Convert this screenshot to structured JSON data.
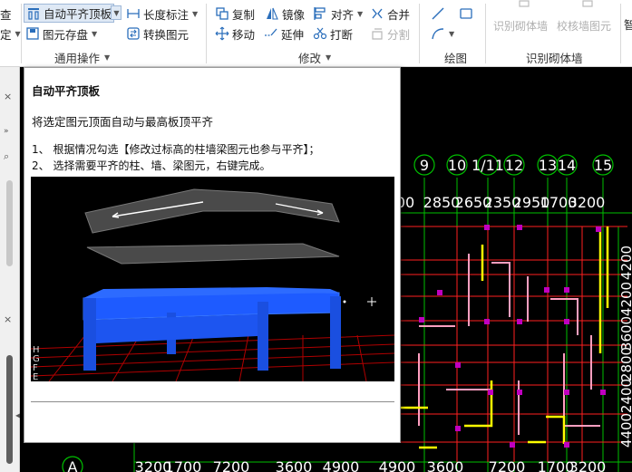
{
  "ribbon": {
    "left_partial_1": "查",
    "left_partial_2": "定",
    "auto_align_top": "自动平齐顶板",
    "length_dimension": "长度标注",
    "element_storage": "图元存盘",
    "convert_element": "转换图元",
    "group_common": "通用操作",
    "copy": "复制",
    "mirror": "镜像",
    "align": "对齐",
    "merge": "合并",
    "move": "移动",
    "extend": "延伸",
    "break": "打断",
    "split": "分割",
    "group_modify": "修改",
    "group_draw": "绘图",
    "identify_masonry_wall": "识别砌体墙",
    "check_wall_element": "校核墙图元",
    "group_identify_masonry": "识别砌体墙",
    "right_partial": "智"
  },
  "tooltip": {
    "title": "自动平齐顶板",
    "description": "将选定图元顶面自动与最高板顶平齐",
    "step1": "1、 根据情况勾选【修改过标高的柱墙梁图元也参与平齐】；",
    "step2": "2、 选择需要平齐的柱、墙、梁图元，右键完成。",
    "axis_labels": [
      "H",
      "G",
      "F",
      "E"
    ]
  },
  "canvas": {
    "axis_bubbles": [
      "9",
      "10",
      "1/11",
      "12",
      "13",
      "14",
      "15",
      "A"
    ],
    "top_dimensions": [
      "00",
      "2850",
      "2650",
      "2350",
      "2950",
      "1700",
      "3200"
    ],
    "bottom_dimensions": [
      "3200",
      "1700",
      "7200",
      "3600",
      "4900",
      "4900",
      "3600",
      "7200",
      "1700",
      "3200"
    ],
    "right_dimensions": [
      "4200",
      "4200",
      "3600",
      "2800",
      "2400",
      "4400"
    ]
  },
  "colors": {
    "ribbon_bg": "#ffffff",
    "canvas_bg": "#000000",
    "grid_line": "#00c000",
    "wall_red": "#ff2020",
    "wall_yellow": "#ffff00",
    "wall_pink": "#ff9fc0",
    "column_magenta": "#c000c0",
    "slab_blue": "#1e5bff"
  }
}
